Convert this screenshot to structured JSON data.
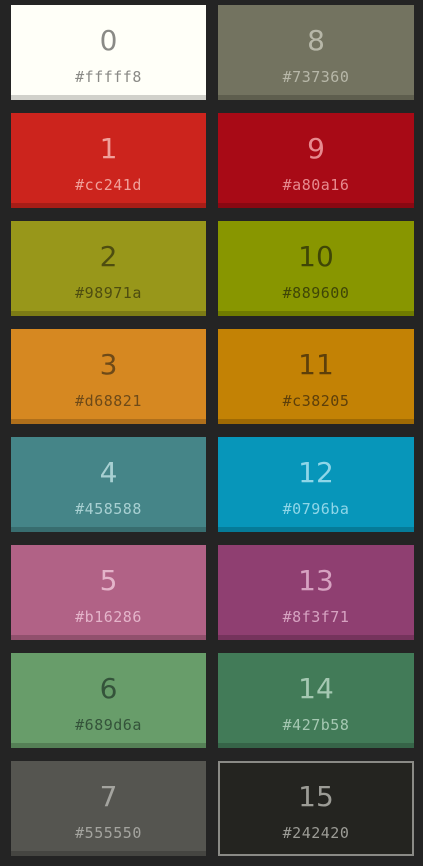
{
  "swatches": [
    {
      "index": "0",
      "hex": "#fffff8",
      "color": "#fffff8",
      "text": "#8a8a86"
    },
    {
      "index": "1",
      "hex": "#cc241d",
      "color": "#cc241d",
      "text": "#f0a09a"
    },
    {
      "index": "2",
      "hex": "#98971a",
      "color": "#98971a",
      "text": "#4e4d10"
    },
    {
      "index": "3",
      "hex": "#d68821",
      "color": "#d68821",
      "text": "#6e4a18"
    },
    {
      "index": "4",
      "hex": "#458588",
      "color": "#458588",
      "text": "#a8d0d2"
    },
    {
      "index": "5",
      "hex": "#b16286",
      "color": "#b16286",
      "text": "#e4b4ca"
    },
    {
      "index": "6",
      "hex": "#689d6a",
      "color": "#689d6a",
      "text": "#34533a"
    },
    {
      "index": "7",
      "hex": "#555550",
      "color": "#555550",
      "text": "#a4a49f"
    },
    {
      "index": "8",
      "hex": "#737360",
      "color": "#737360",
      "text": "#b7b7a8"
    },
    {
      "index": "9",
      "hex": "#a80a16",
      "color": "#a80a16",
      "text": "#e78a8f"
    },
    {
      "index": "10",
      "hex": "#889600",
      "color": "#889600",
      "text": "#3f4606"
    },
    {
      "index": "11",
      "hex": "#c38205",
      "color": "#c38205",
      "text": "#5d3f0a"
    },
    {
      "index": "12",
      "hex": "#0796ba",
      "color": "#0796ba",
      "text": "#8fd6e8"
    },
    {
      "index": "13",
      "hex": "#8f3f71",
      "color": "#8f3f71",
      "text": "#d6a2c1"
    },
    {
      "index": "14",
      "hex": "#427b58",
      "color": "#427b58",
      "text": "#a5c8b2"
    },
    {
      "index": "15",
      "hex": "#242420",
      "color": "#242420",
      "text": "#9c9c96",
      "selected": true
    }
  ]
}
